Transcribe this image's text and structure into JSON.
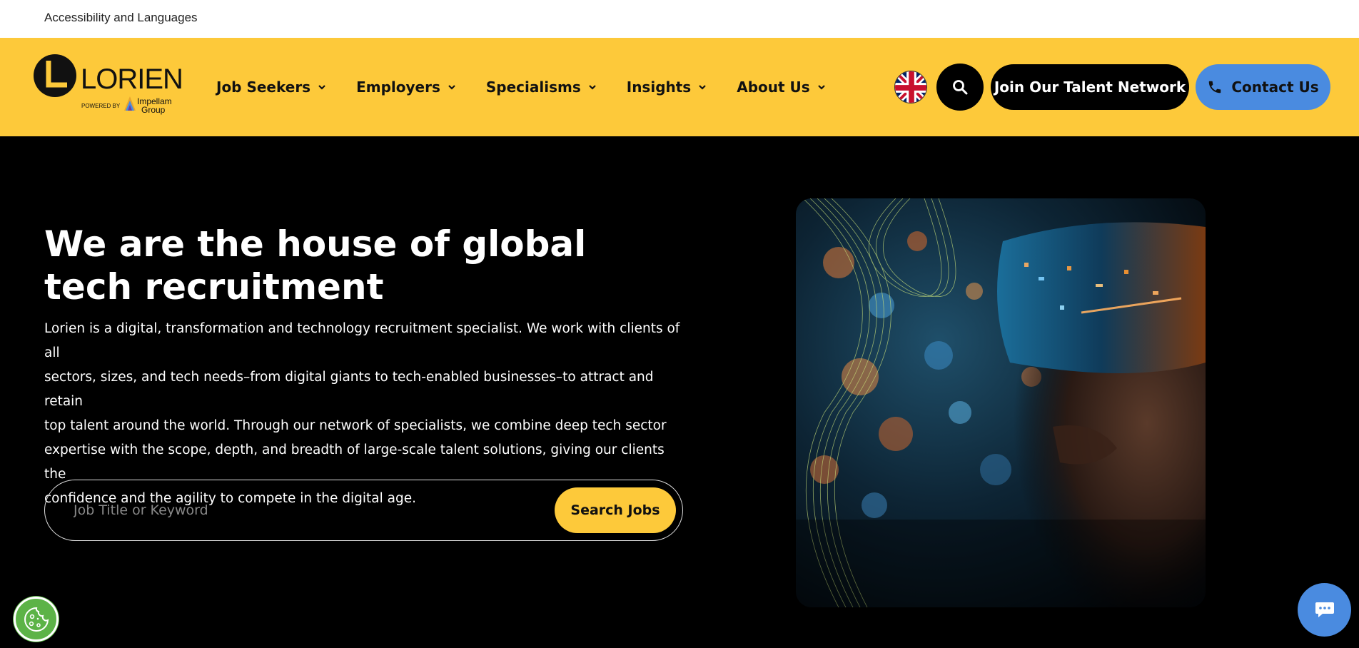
{
  "topbar": {
    "accessibility_link": "Accessibility and Languages"
  },
  "logo": {
    "brand": "LORIEN",
    "powered_by": "POWERED BY",
    "group_line1": "Impellam",
    "group_line2": "Group"
  },
  "nav": {
    "items": [
      {
        "label": "Job Seekers"
      },
      {
        "label": "Employers"
      },
      {
        "label": "Specialisms"
      },
      {
        "label": "Insights"
      },
      {
        "label": "About Us"
      }
    ]
  },
  "header_actions": {
    "language_flag": "uk-flag-icon",
    "search_icon": "search-icon",
    "join_label": "Join Our Talent Network",
    "contact_label": "Contact Us",
    "contact_icon": "phone-icon"
  },
  "hero": {
    "title_line1": "We are the house of global",
    "title_line2": "tech recruitment",
    "paragraph_lines": [
      "Lorien is a digital, transformation and technology recruitment specialist. We work with clients of all",
      "sectors, sizes, and tech needs–from digital giants to tech-enabled businesses–to attract and retain",
      "top talent around the world. Through our network of specialists, we combine deep tech sector",
      "expertise with the scope, depth, and breadth of large-scale talent solutions, giving our clients the",
      "confidence and the agility to compete in the digital age."
    ]
  },
  "search": {
    "placeholder": "Job Title or Keyword",
    "button_label": "Search Jobs"
  },
  "widgets": {
    "cookie_icon": "cookie-icon",
    "chat_icon": "chat-icon"
  },
  "colors": {
    "header_yellow": "#fdc93a",
    "contact_blue": "#4a8be0",
    "cookie_green": "#5cb347",
    "background": "#000000"
  }
}
